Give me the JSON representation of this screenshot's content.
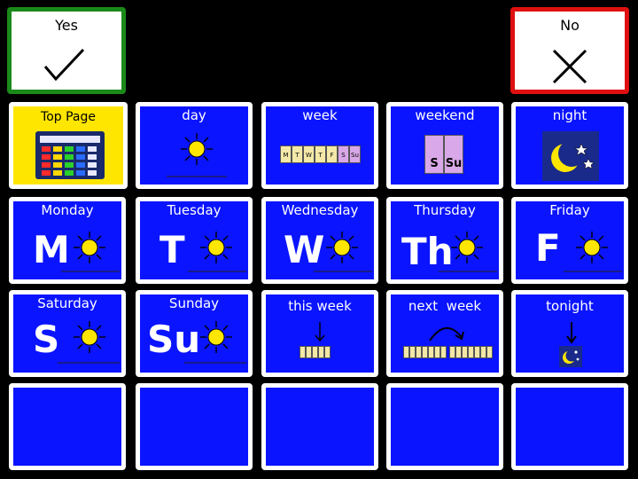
{
  "yes_button": {
    "label": "Yes"
  },
  "no_button": {
    "label": "No"
  },
  "top_page": {
    "label": "Top Page"
  },
  "row1": [
    {
      "name": "day",
      "label": "day"
    },
    {
      "name": "week",
      "label": "week"
    },
    {
      "name": "weekend",
      "label": "weekend"
    },
    {
      "name": "night",
      "label": "night"
    }
  ],
  "days": [
    {
      "name": "monday",
      "label": "Monday",
      "letter": "M"
    },
    {
      "name": "tuesday",
      "label": "Tuesday",
      "letter": "T"
    },
    {
      "name": "wednesday",
      "label": "Wednesday",
      "letter": "W"
    },
    {
      "name": "thursday",
      "label": "Thursday",
      "letter": "Th"
    },
    {
      "name": "friday",
      "label": "Friday",
      "letter": "F"
    },
    {
      "name": "saturday",
      "label": "Saturday",
      "letter": "S"
    },
    {
      "name": "sunday",
      "label": "Sunday",
      "letter": "Su"
    }
  ],
  "row3_extra": [
    {
      "name": "this-week",
      "label": "this week"
    },
    {
      "name": "next-week",
      "label": "next  week"
    },
    {
      "name": "tonight",
      "label": "tonight"
    }
  ],
  "weekend_letters": [
    "S",
    "Su"
  ],
  "week_letters": [
    "M",
    "T",
    "W",
    "T",
    "F",
    "S",
    "Su"
  ],
  "colors": {
    "tile_blue": "#0a14ff",
    "yes_border": "#1a8a1a",
    "no_border": "#e01010",
    "top_page_yellow": "#ffe600",
    "sun": "#ffe600"
  },
  "icons": {
    "yes": "checkmark-icon",
    "no": "x-mark-icon",
    "top_page": "keyboard-grid-icon",
    "sun": "sun-icon",
    "night": "moon-stars-icon"
  }
}
